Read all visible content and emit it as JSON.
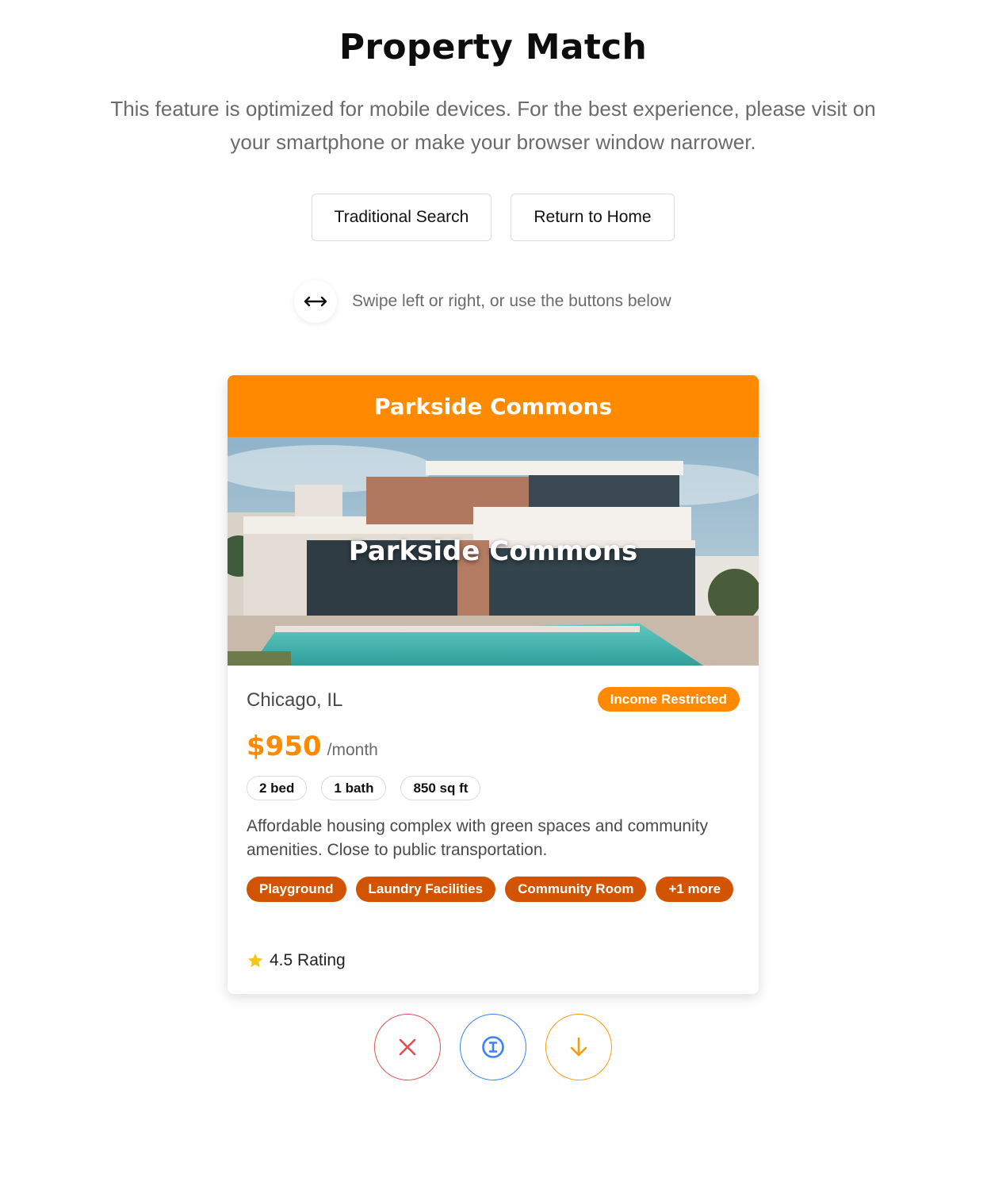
{
  "header": {
    "title": "Property Match",
    "subtitle": "This feature is optimized for mobile devices. For the best experience, please visit on your smartphone or make your browser window narrower."
  },
  "nav": {
    "traditional_search": "Traditional Search",
    "return_home": "Return to Home"
  },
  "hint": {
    "icon": "swipe-arrows-icon",
    "text": "Swipe left or right, or use the buttons below"
  },
  "card": {
    "header_title": "Parkside Commons",
    "image_title": "Parkside Commons",
    "location": "Chicago, IL",
    "badge": "Income Restricted",
    "price": "$950",
    "price_unit": "/month",
    "specs": [
      "2 bed",
      "1 bath",
      "850 sq ft"
    ],
    "description": "Affordable housing complex with green spaces and community amenities. Close to public transportation.",
    "amenities": [
      "Playground",
      "Laundry Facilities",
      "Community Room",
      "+1 more"
    ],
    "rating": "4.5 Rating"
  },
  "actions": [
    {
      "name": "reject",
      "icon": "close-icon",
      "color": "#e05252"
    },
    {
      "name": "info",
      "icon": "info-icon",
      "color": "#3b82f6"
    },
    {
      "name": "save",
      "icon": "arrow-down-icon",
      "color": "#f59e0b"
    }
  ],
  "colors": {
    "accent": "#ff8a00",
    "amenity": "#d35400"
  }
}
